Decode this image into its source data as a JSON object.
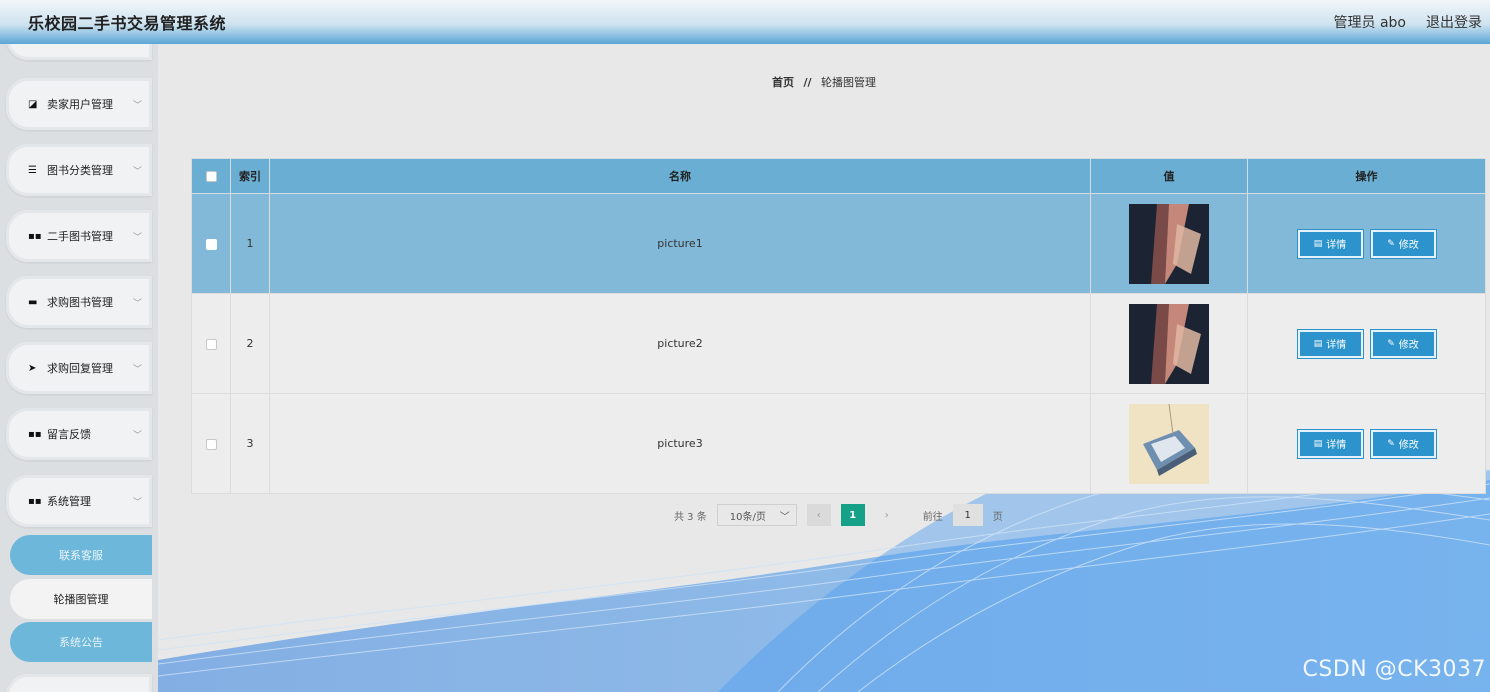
{
  "header": {
    "title": "乐校园二手书交易管理系统",
    "user": "管理员 abo",
    "logout": "退出登录"
  },
  "sidebar": {
    "items": [
      {
        "label": "卖家用户管理",
        "icon": "chart-icon"
      },
      {
        "label": "图书分类管理",
        "icon": "list-icon"
      },
      {
        "label": "二手图书管理",
        "icon": "grid-icon"
      },
      {
        "label": "求购图书管理",
        "icon": "monitor-icon"
      },
      {
        "label": "求购回复管理",
        "icon": "send-icon"
      },
      {
        "label": "留言反馈",
        "icon": "grid-icon"
      },
      {
        "label": "系统管理",
        "icon": "grid-icon"
      }
    ],
    "sub_items": [
      "联系客服",
      "轮播图管理",
      "系统公告"
    ]
  },
  "breadcrumb": {
    "home": "首页",
    "sep": "//",
    "current": "轮播图管理"
  },
  "table": {
    "headers": [
      "索引",
      "名称",
      "值",
      "操作"
    ],
    "rows": [
      {
        "index": "1",
        "name": "picture1"
      },
      {
        "index": "2",
        "name": "picture2"
      },
      {
        "index": "3",
        "name": "picture3"
      }
    ],
    "detail_label": "详情",
    "edit_label": "修改"
  },
  "pagination": {
    "total": "共 3 条",
    "page_size": "10条/页",
    "current": "1",
    "goto": "前往",
    "goto_value": "1",
    "page_suffix": "页"
  },
  "watermark": "CSDN @CK3037",
  "colors": {
    "accent": "#2c93cd",
    "header_row": "#6aafd3",
    "page_active": "#15a187"
  }
}
